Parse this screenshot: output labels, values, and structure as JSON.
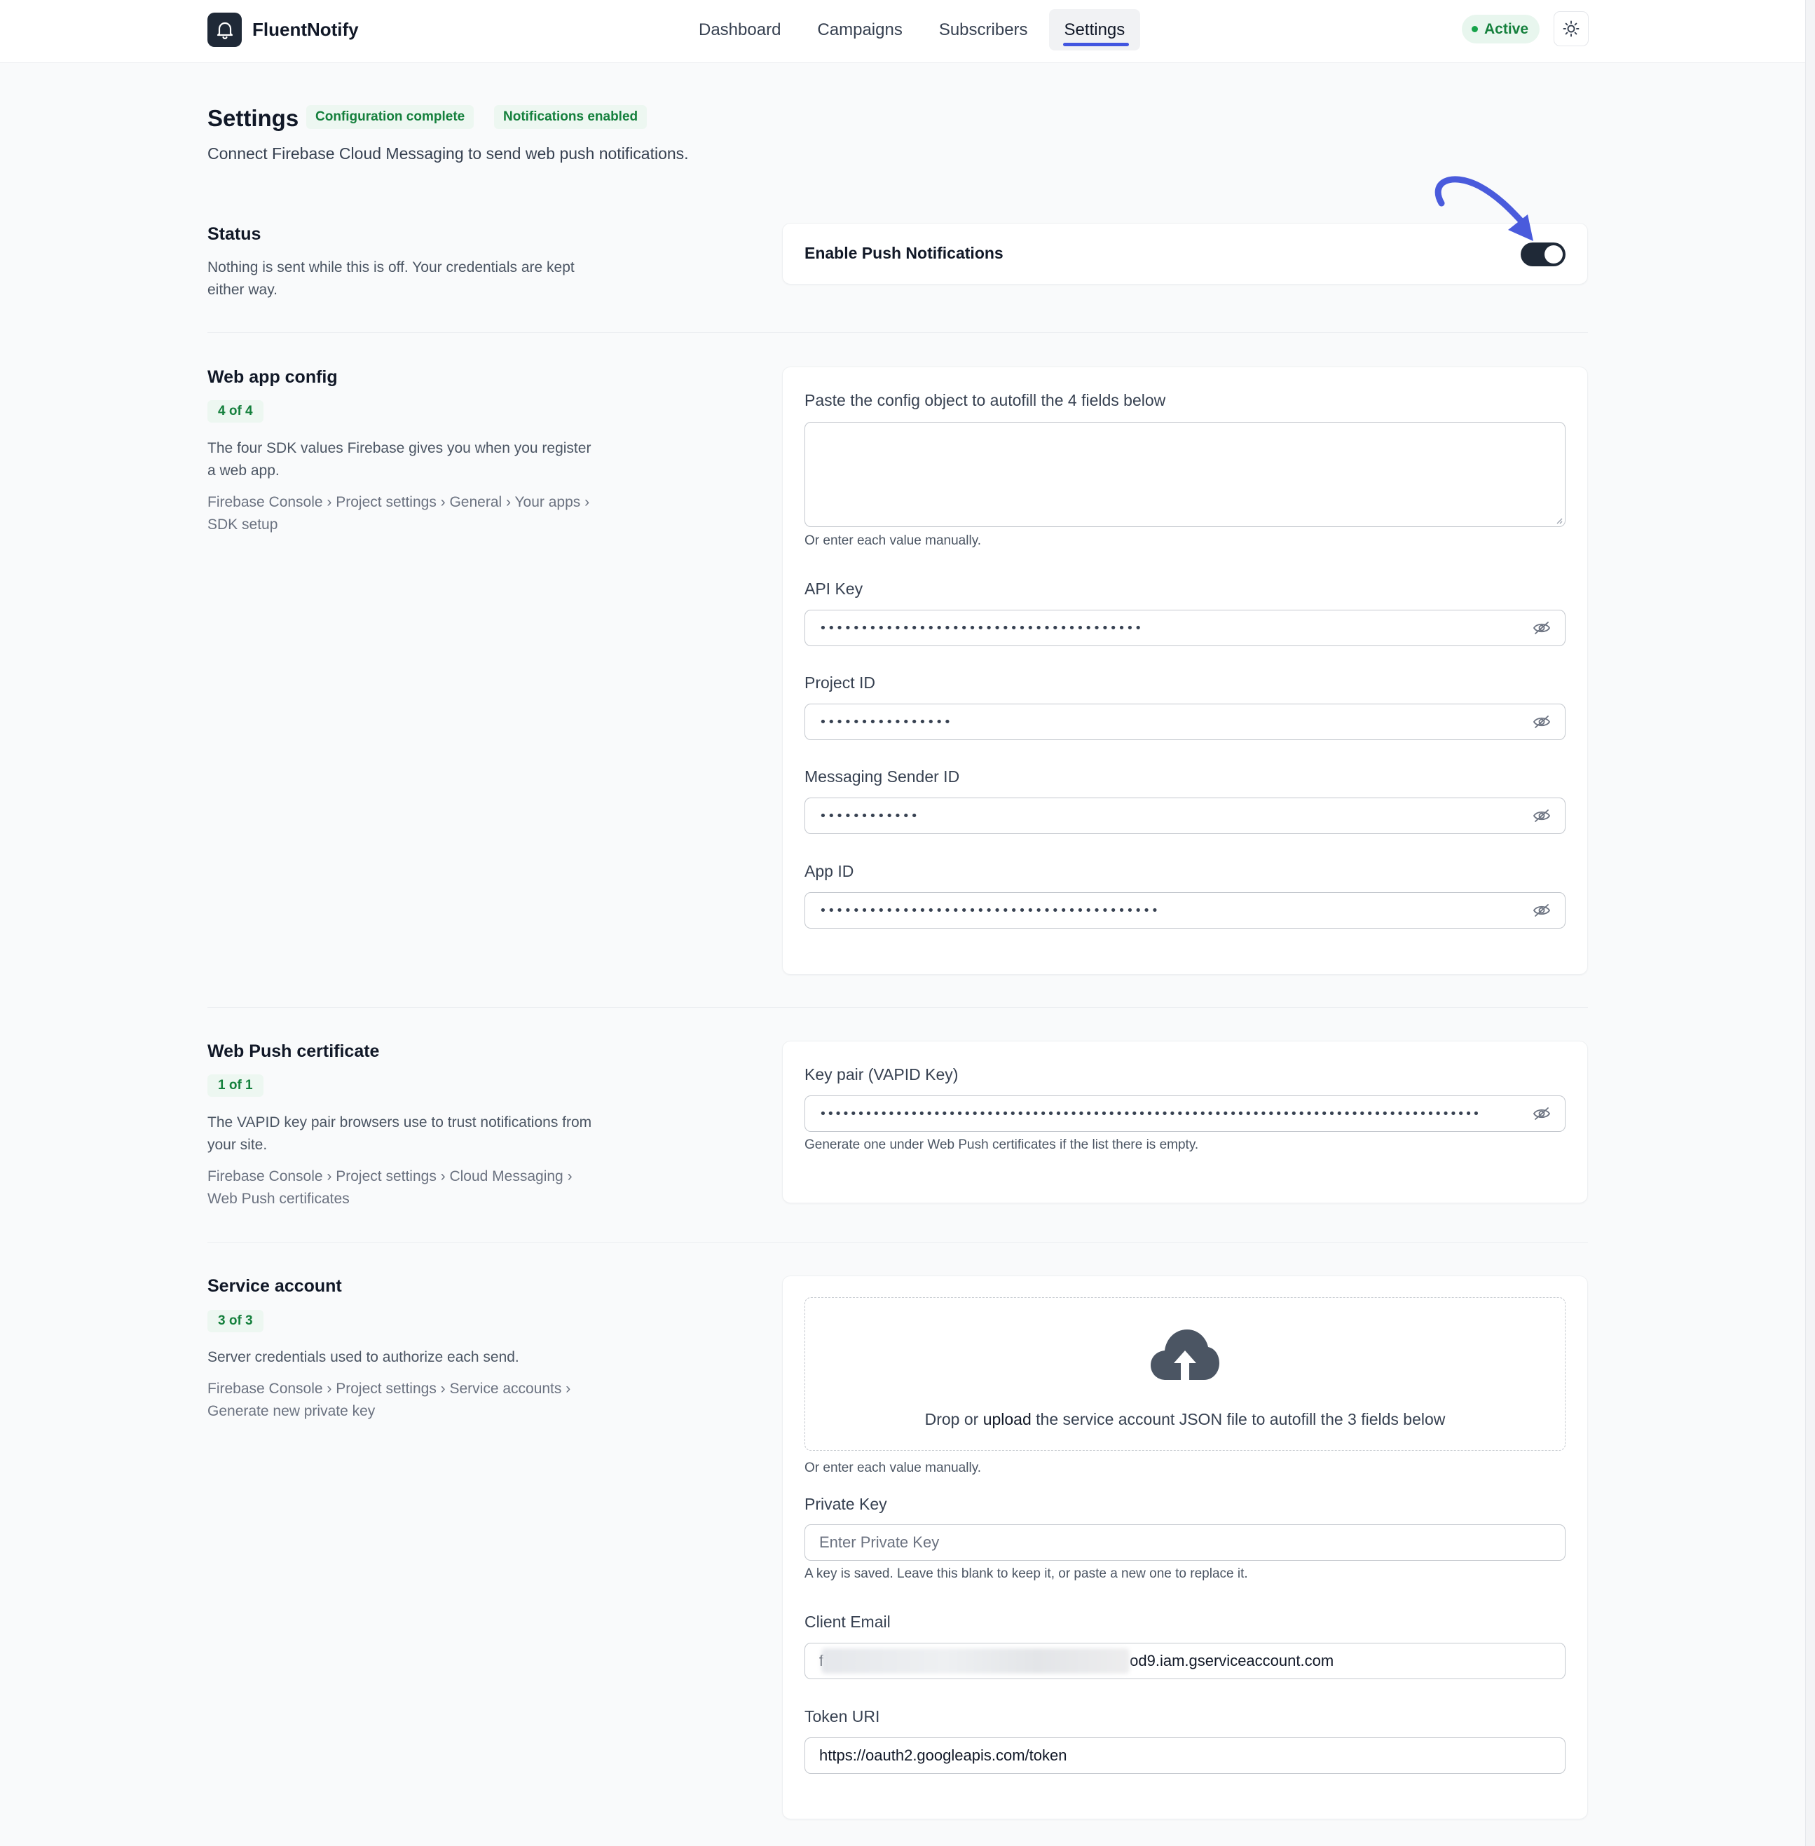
{
  "app": {
    "name": "FluentNotify",
    "logo_icon": "bell-icon",
    "status_label": "Active"
  },
  "nav": {
    "items": [
      "Dashboard",
      "Campaigns",
      "Subscribers",
      "Settings"
    ],
    "active": "Settings"
  },
  "page": {
    "title": "Settings",
    "tags": [
      "Configuration complete",
      "Notifications enabled"
    ],
    "subtitle": "Connect Firebase Cloud Messaging to send web push notifications."
  },
  "status_section": {
    "title": "Status",
    "description": "Nothing is sent while this is off. Your credentials are kept either way.",
    "toggle_label": "Enable Push Notifications",
    "toggle_on": true
  },
  "web_app_config": {
    "title": "Web app config",
    "count": "4 of 4",
    "description": "The four SDK values Firebase gives you when you register a web app.",
    "path": "Firebase Console › Project settings › General › Your apps › SDK setup",
    "paste_label": "Paste the config object to autofill the 4 fields below",
    "paste_value": "",
    "manual_hint": "Or enter each value manually.",
    "fields": [
      {
        "label": "API Key",
        "value": "•••••••••••••••••••••••••••••••••••••••"
      },
      {
        "label": "Project ID",
        "value": "••••••••••••••••"
      },
      {
        "label": "Messaging Sender ID",
        "value": "••••••••••••"
      },
      {
        "label": "App ID",
        "value": "•••••••••••••••••••••••••••••••••••••••••"
      }
    ]
  },
  "web_push_cert": {
    "title": "Web Push certificate",
    "count": "1 of 1",
    "description": "The VAPID key pair browsers use to trust notifications from your site.",
    "path": "Firebase Console › Project settings › Cloud Messaging › Web Push certificates",
    "field_label": "Key pair (VAPID Key)",
    "field_value": "•••••••••••••••••••••••••••••••••••••••••••••••••••••••••••••••••••••••••••••••••••••••",
    "hint": "Generate one under Web Push certificates if the list there is empty."
  },
  "service_account": {
    "title": "Service account",
    "count": "3 of 3",
    "description": "Server credentials used to authorize each send.",
    "path": "Firebase Console › Project settings › Service accounts › Generate new private key",
    "drop_prefix": "Drop or",
    "drop_link": "upload",
    "drop_suffix": "the service account JSON file to autofill the 3 fields below",
    "manual_hint": "Or enter each value manually.",
    "private_key_label": "Private Key",
    "private_key_placeholder": "Enter Private Key",
    "private_key_hint": "A key is saved. Leave this blank to keep it, or paste a new one to replace it.",
    "client_email_label": "Client Email",
    "client_email_prefix": "f",
    "client_email_suffix": "od9.iam.gserviceaccount.com",
    "token_uri_label": "Token URI",
    "token_uri_value": "https://oauth2.googleapis.com/token"
  },
  "colors": {
    "accent": "#4256e0",
    "success": "#15803d",
    "toggle_on": "#1f2937",
    "annotation_arrow": "#4a5bdc"
  }
}
